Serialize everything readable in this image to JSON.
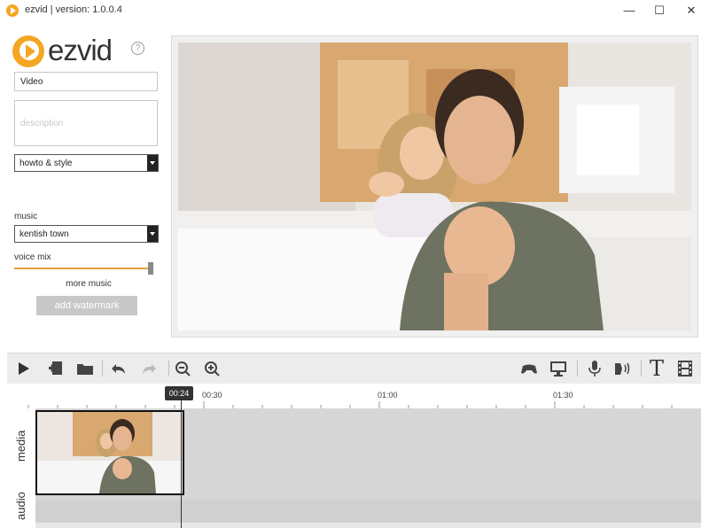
{
  "window": {
    "title": "ezvid | version: 1.0.0.4",
    "minimize": "—",
    "maximize": "☐",
    "close": "✕"
  },
  "logo": {
    "text": "ezvid",
    "help": "?"
  },
  "form": {
    "title_value": "Video",
    "description_placeholder": "description",
    "category_value": "howto & style",
    "music_label": "music",
    "music_value": "kentish town",
    "voice_mix_label": "voice mix",
    "voice_mix_level": 0.97,
    "more_music": "more music",
    "watermark_button": "add watermark"
  },
  "toolbar": {
    "left_icons": [
      "play-icon",
      "add-media-icon",
      "open-folder-icon",
      "undo-icon",
      "redo-icon",
      "zoom-out-icon",
      "zoom-in-icon"
    ],
    "right_icons": [
      "gamepad-icon",
      "monitor-icon",
      "microphone-icon",
      "speech-icon",
      "text-icon",
      "film-strip-icon"
    ],
    "text_glyph": "T"
  },
  "timeline": {
    "playhead": "00:24",
    "ticks": [
      "00:30",
      "01:00",
      "01:30"
    ],
    "tracks": [
      "media",
      "audio"
    ]
  },
  "colors": {
    "accent": "#f5a623",
    "slider": "#e0a040",
    "timeline_bg": "#d6d6d6"
  }
}
